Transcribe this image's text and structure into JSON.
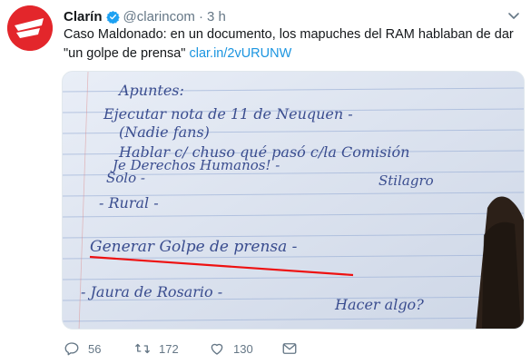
{
  "account": {
    "name": "Clarín",
    "handle": "@clarincom",
    "separator": "·",
    "time": "3 h",
    "avatar_color": "#e3262b",
    "verified_color": "#1da1f2"
  },
  "tweet": {
    "text": "Caso Maldonado: en un documento, los mapuches del RAM hablaban de dar \"un golpe de prensa\" ",
    "link": "clar.in/2vURUNW",
    "link_color": "#1b95e0"
  },
  "image": {
    "handwriting": [
      "Apuntes:",
      "Ejecutar nota de 11 de Neuquen -",
      "(Nadie fans)",
      "Hablar c/ chuso qué pasó c/la Comisión",
      "Je Derechos Humanos! -",
      "Solo -",
      "Stilagro",
      "- Rural -",
      "Generar Golpe de prensa -",
      "- Jaura de Rosario -",
      "Hacer algo?"
    ]
  },
  "actions": {
    "reply_count": "56",
    "retweet_count": "172",
    "like_count": "130",
    "reply_icon": "reply-icon",
    "retweet_icon": "retweet-icon",
    "like_icon": "heart-icon",
    "dm_icon": "direct-message-icon"
  }
}
